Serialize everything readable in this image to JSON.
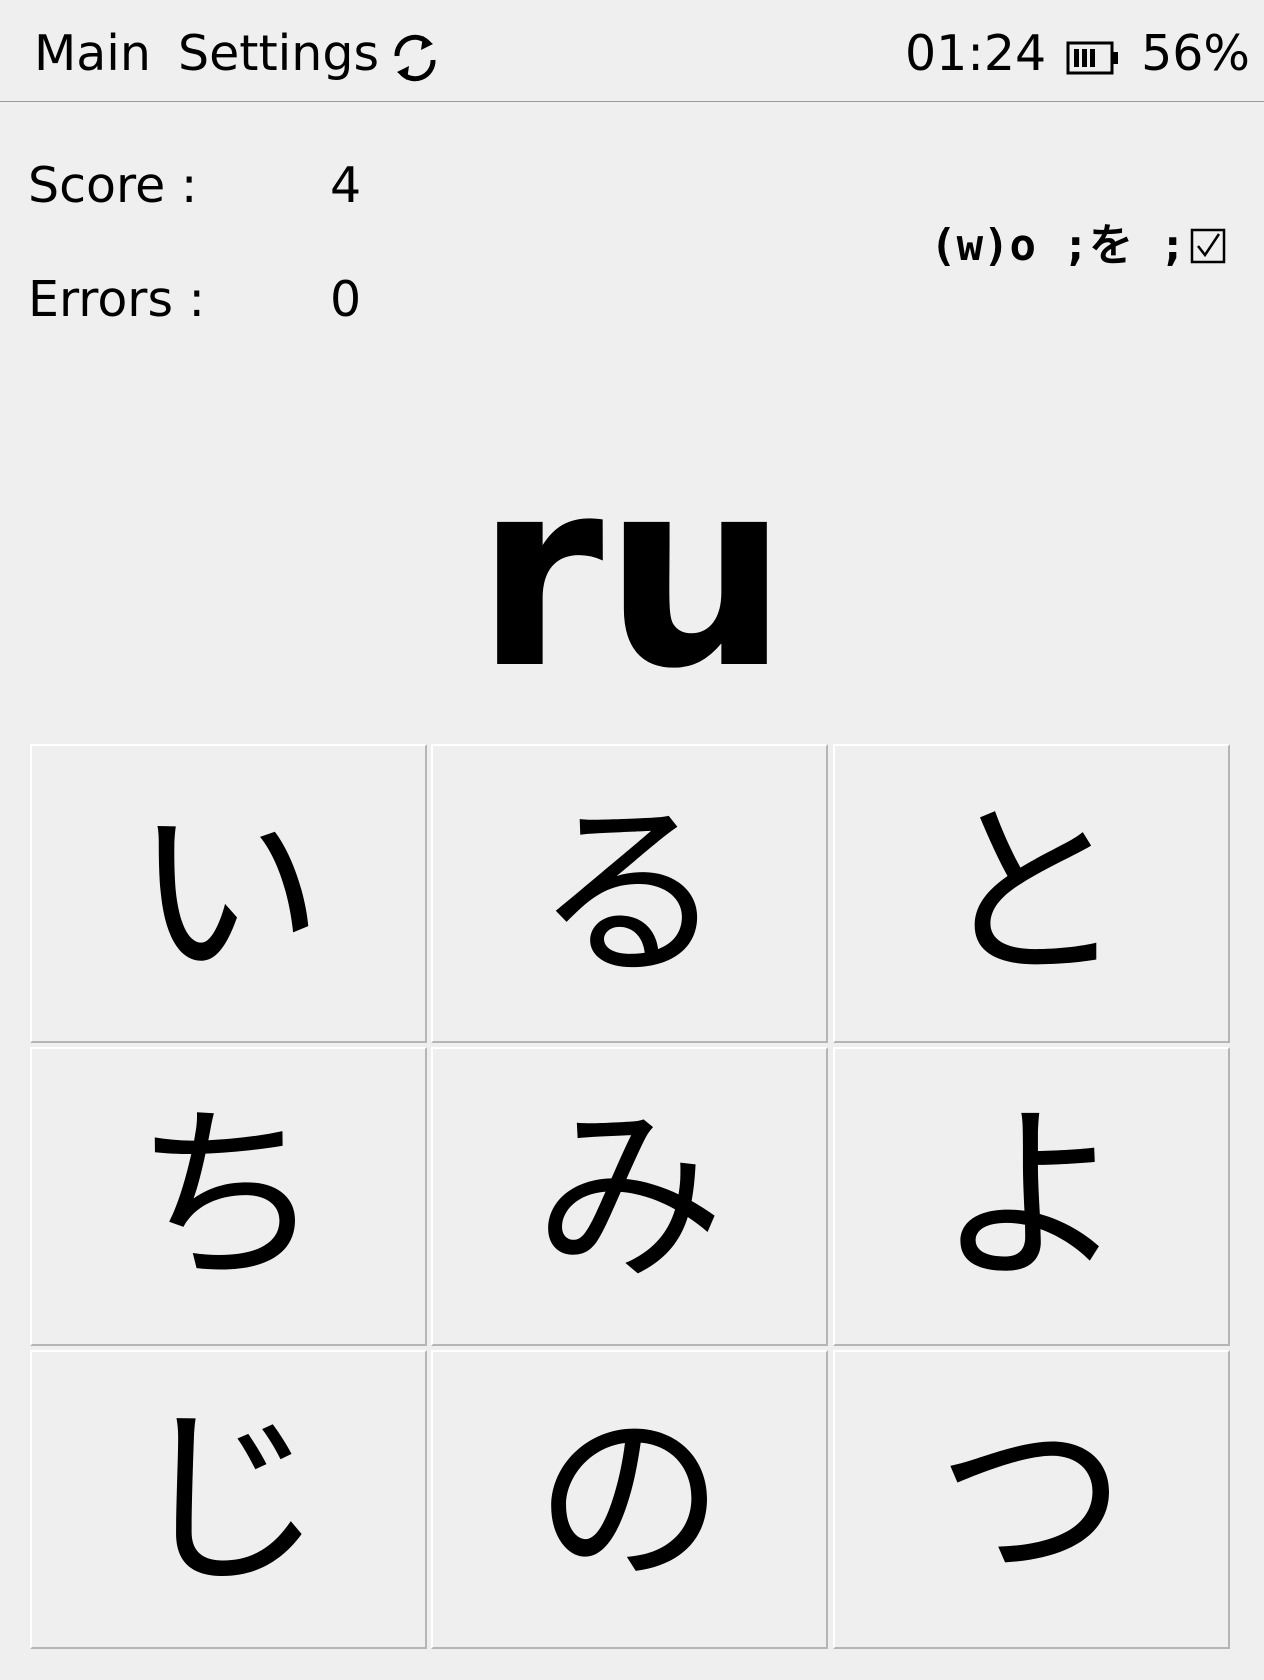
{
  "nav": {
    "main_label": "Main",
    "settings_label": "Settings",
    "refresh_icon": "refresh-icon"
  },
  "status": {
    "time": "01:24",
    "battery_icon": "battery-icon",
    "battery_percent": "56%"
  },
  "stats": {
    "score_label": "Score :",
    "score_value": "4",
    "errors_label": "Errors :",
    "errors_value": "0"
  },
  "last_answer": {
    "text": "(w)o ;を ;",
    "check_icon": "checked-box-icon"
  },
  "prompt": "ru",
  "choices": [
    "い",
    "る",
    "と",
    "ち",
    "み",
    "よ",
    "じ",
    "の",
    "つ"
  ]
}
